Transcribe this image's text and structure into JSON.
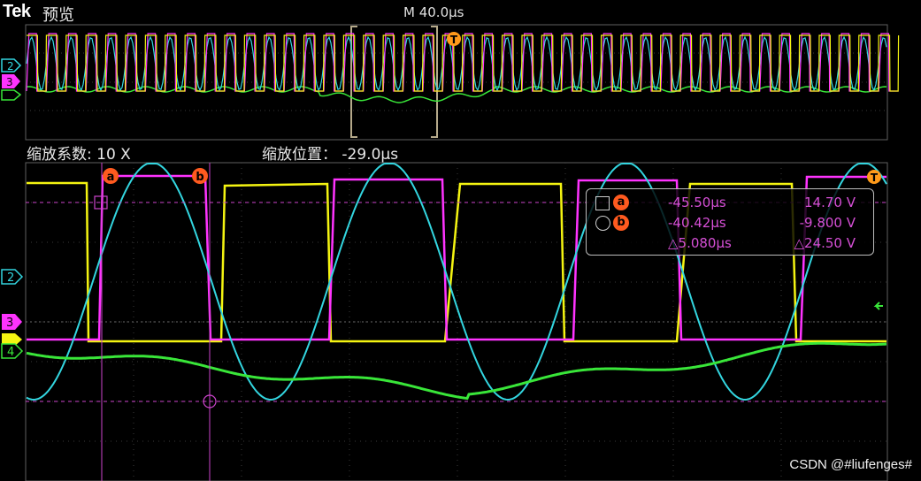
{
  "header": {
    "brand": "Tek",
    "mode": "预览",
    "timebase": "M 40.0µs"
  },
  "zoom_bar": {
    "factor": "缩放系数: 10 X",
    "position": "缩放位置： -29.0µs"
  },
  "channels": [
    {
      "id": "2",
      "color": "#33d6e0"
    },
    {
      "id": "3",
      "color": "#ff33ff"
    },
    {
      "id": "4",
      "color": "#39e639"
    },
    {
      "id": "1",
      "color": "#f4f411"
    }
  ],
  "trigger_marker": "T",
  "cursors": {
    "a": {
      "label": "a",
      "time": "-45.50µs",
      "volt": "14.70 V"
    },
    "b": {
      "label": "b",
      "time": "-40.42µs",
      "volt": "-9.800 V"
    },
    "delta": {
      "time": "△5.080µs",
      "volt": "△24.50 V"
    }
  },
  "footer": "CSDN @#liufenges#"
}
